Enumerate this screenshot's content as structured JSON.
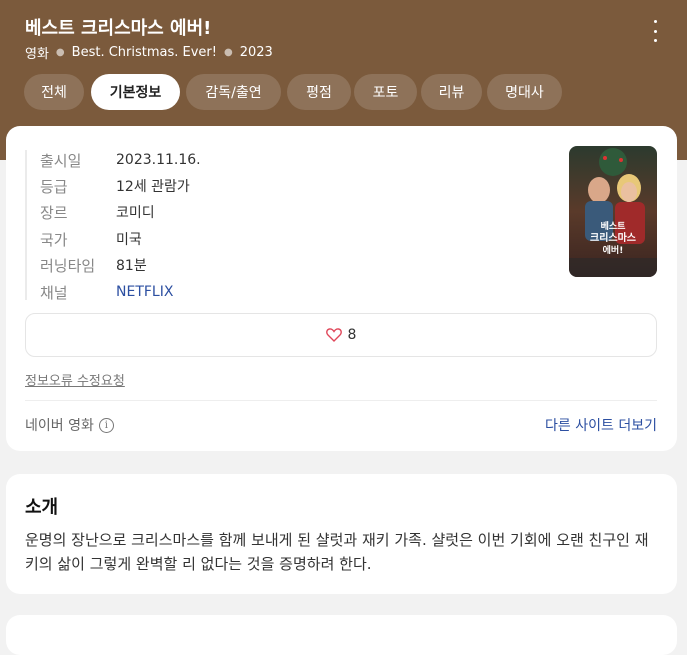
{
  "header": {
    "title": "베스트 크리스마스 에버!",
    "meta": {
      "genre_label": "영화",
      "original_title": "Best. Christmas. Ever!",
      "year": "2023"
    }
  },
  "tabs": [
    {
      "label": "전체",
      "active": false
    },
    {
      "label": "기본정보",
      "active": true
    },
    {
      "label": "감독/출연",
      "active": false
    },
    {
      "label": "평점",
      "active": false
    },
    {
      "label": "포토",
      "active": false
    },
    {
      "label": "리뷰",
      "active": false
    },
    {
      "label": "명대사",
      "active": false
    }
  ],
  "info": {
    "rows": [
      {
        "label": "출시일",
        "value": "2023.11.16."
      },
      {
        "label": "등급",
        "value": "12세 관람가"
      },
      {
        "label": "장르",
        "value": "코미디"
      },
      {
        "label": "국가",
        "value": "미국"
      },
      {
        "label": "러닝타임",
        "value": "81분"
      },
      {
        "label": "채널",
        "value": "NETFLIX"
      }
    ],
    "poster_text": [
      "베스트",
      "크리스마스",
      "에버!"
    ],
    "like_count": "8",
    "report_link": "정보오류 수정요청",
    "source": "네이버 영화",
    "more_sites": "다른 사이트 더보기"
  },
  "intro": {
    "title": "소개",
    "text": "운명의 장난으로 크리스마스를 함께 보내게 된 샬럿과 재키 가족. 샬럿은 이번 기회에 오랜 친구인 재키의 삶이 그렇게 완벽할 리 없다는 것을 증명하려 한다."
  },
  "colors": {
    "header_bg": "#7b5a3c",
    "link": "#2c4fa1",
    "heart": "#e0475a"
  },
  "icons": [
    "more-vertical-icon",
    "heart-icon",
    "info-icon"
  ]
}
